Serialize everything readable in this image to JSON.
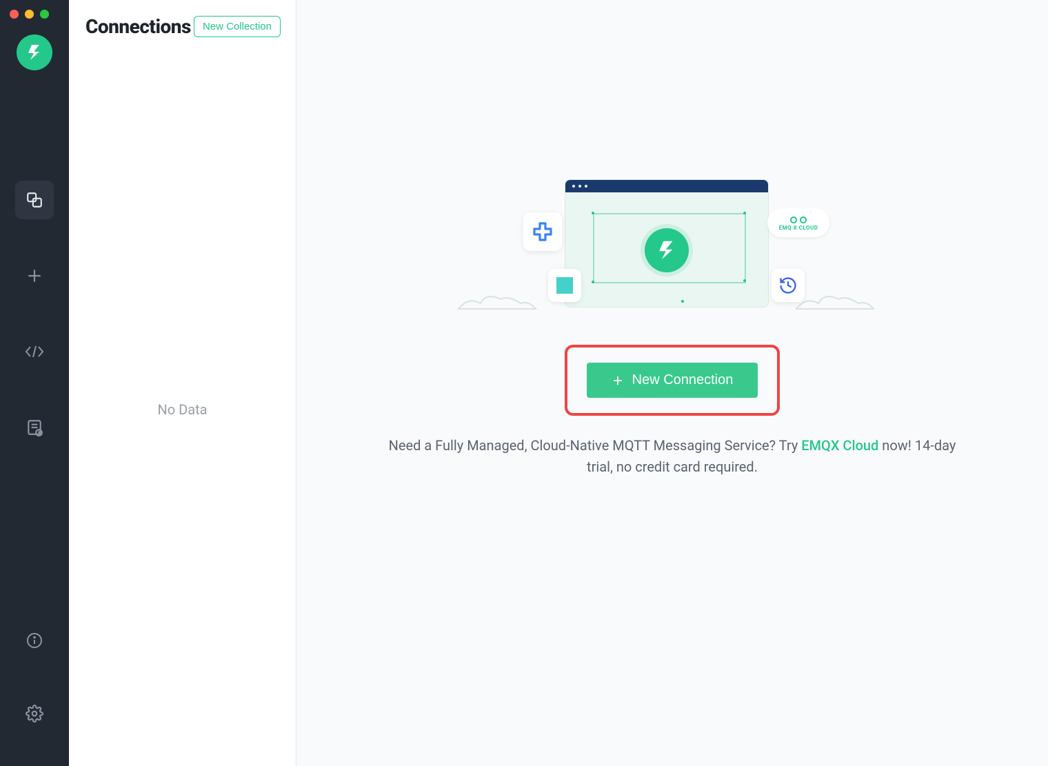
{
  "panel": {
    "title": "Connections",
    "new_collection_label": "New Collection",
    "empty_text": "No Data"
  },
  "rail": {
    "items": [
      {
        "name": "connections",
        "active": true
      },
      {
        "name": "new",
        "active": false
      },
      {
        "name": "scripts",
        "active": false
      },
      {
        "name": "logs",
        "active": false
      }
    ],
    "bottom": [
      {
        "name": "info"
      },
      {
        "name": "settings"
      }
    ]
  },
  "main": {
    "cloud_label": "EMQ X CLOUD",
    "new_connection_label": "New Connection",
    "promo_before": "Need a Fully Managed, Cloud-Native MQTT Messaging Service? Try ",
    "promo_link": "EMQX Cloud",
    "promo_after": " now! 14-day trial, no credit card required."
  }
}
